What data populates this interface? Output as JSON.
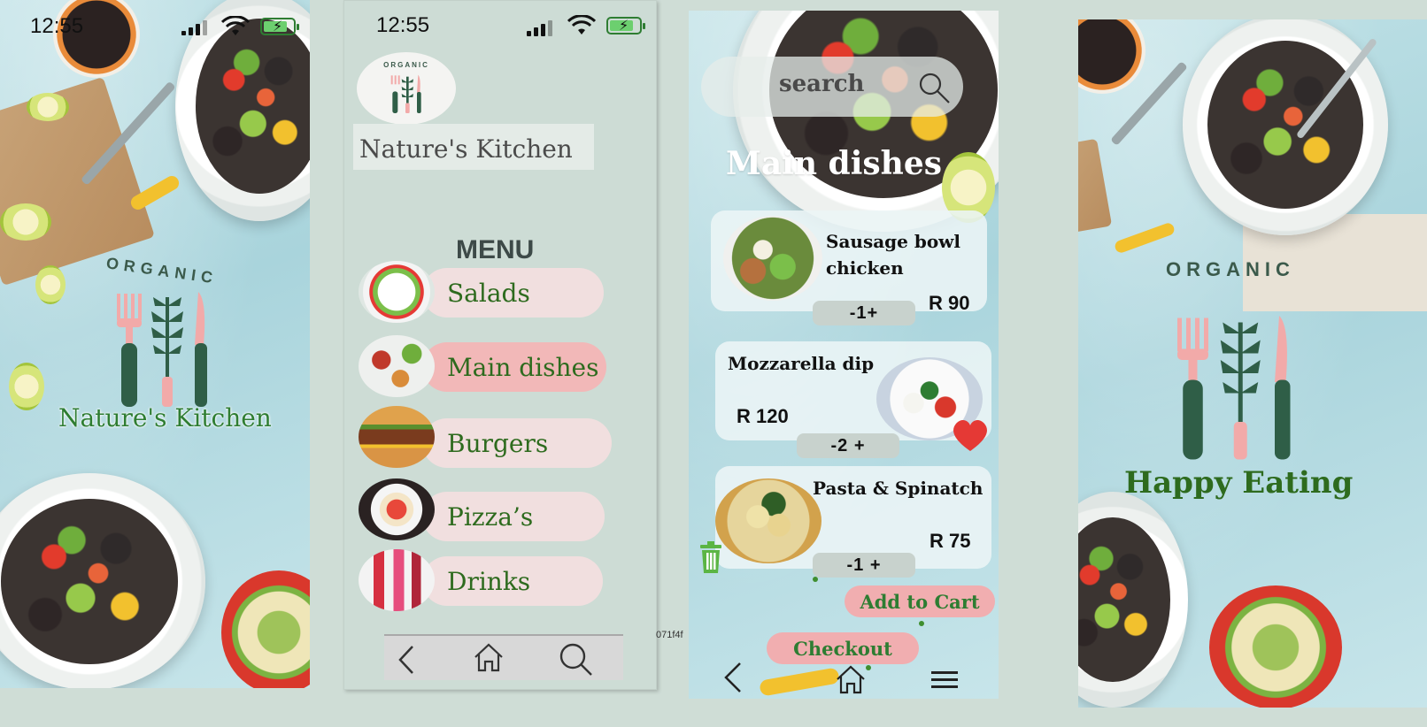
{
  "status": {
    "time": "12:55"
  },
  "brand": {
    "organic": "ORGANIC",
    "name": "Nature's Kitchen",
    "tagline": "Happy Eating"
  },
  "menu": {
    "heading": "MENU",
    "items": [
      {
        "label": "Salads"
      },
      {
        "label": "Main dishes",
        "active": true
      },
      {
        "label": "Burgers"
      },
      {
        "label": "Pizza’s"
      },
      {
        "label": "Drinks"
      }
    ]
  },
  "order": {
    "search_placeholder": "search",
    "section": "Main dishes",
    "dishes": [
      {
        "name": "Sausage bowl chicken",
        "price": "R 90",
        "qty": "-1+"
      },
      {
        "name": "Mozzarella dip",
        "price": "R 120",
        "qty": "-2 +"
      },
      {
        "name": "Pasta & Spinatch",
        "price": "R 75",
        "qty": "-1 +"
      }
    ],
    "add_to_cart": "Add to Cart",
    "checkout": "Checkout"
  },
  "hex_label": "071f4f",
  "colors": {
    "brand_green": "#2e7d32",
    "pill_pink": "#f1dfdf",
    "pill_active": "#f2b8b8",
    "app_bg": "#cddcd5",
    "heart": "#e53935"
  },
  "icons": [
    "signal-icon",
    "wifi-icon",
    "battery-icon",
    "search-icon",
    "back-icon",
    "home-icon",
    "menu-icon",
    "heart-icon",
    "trash-icon",
    "fork-icon",
    "knife-icon",
    "leaf-icon"
  ]
}
